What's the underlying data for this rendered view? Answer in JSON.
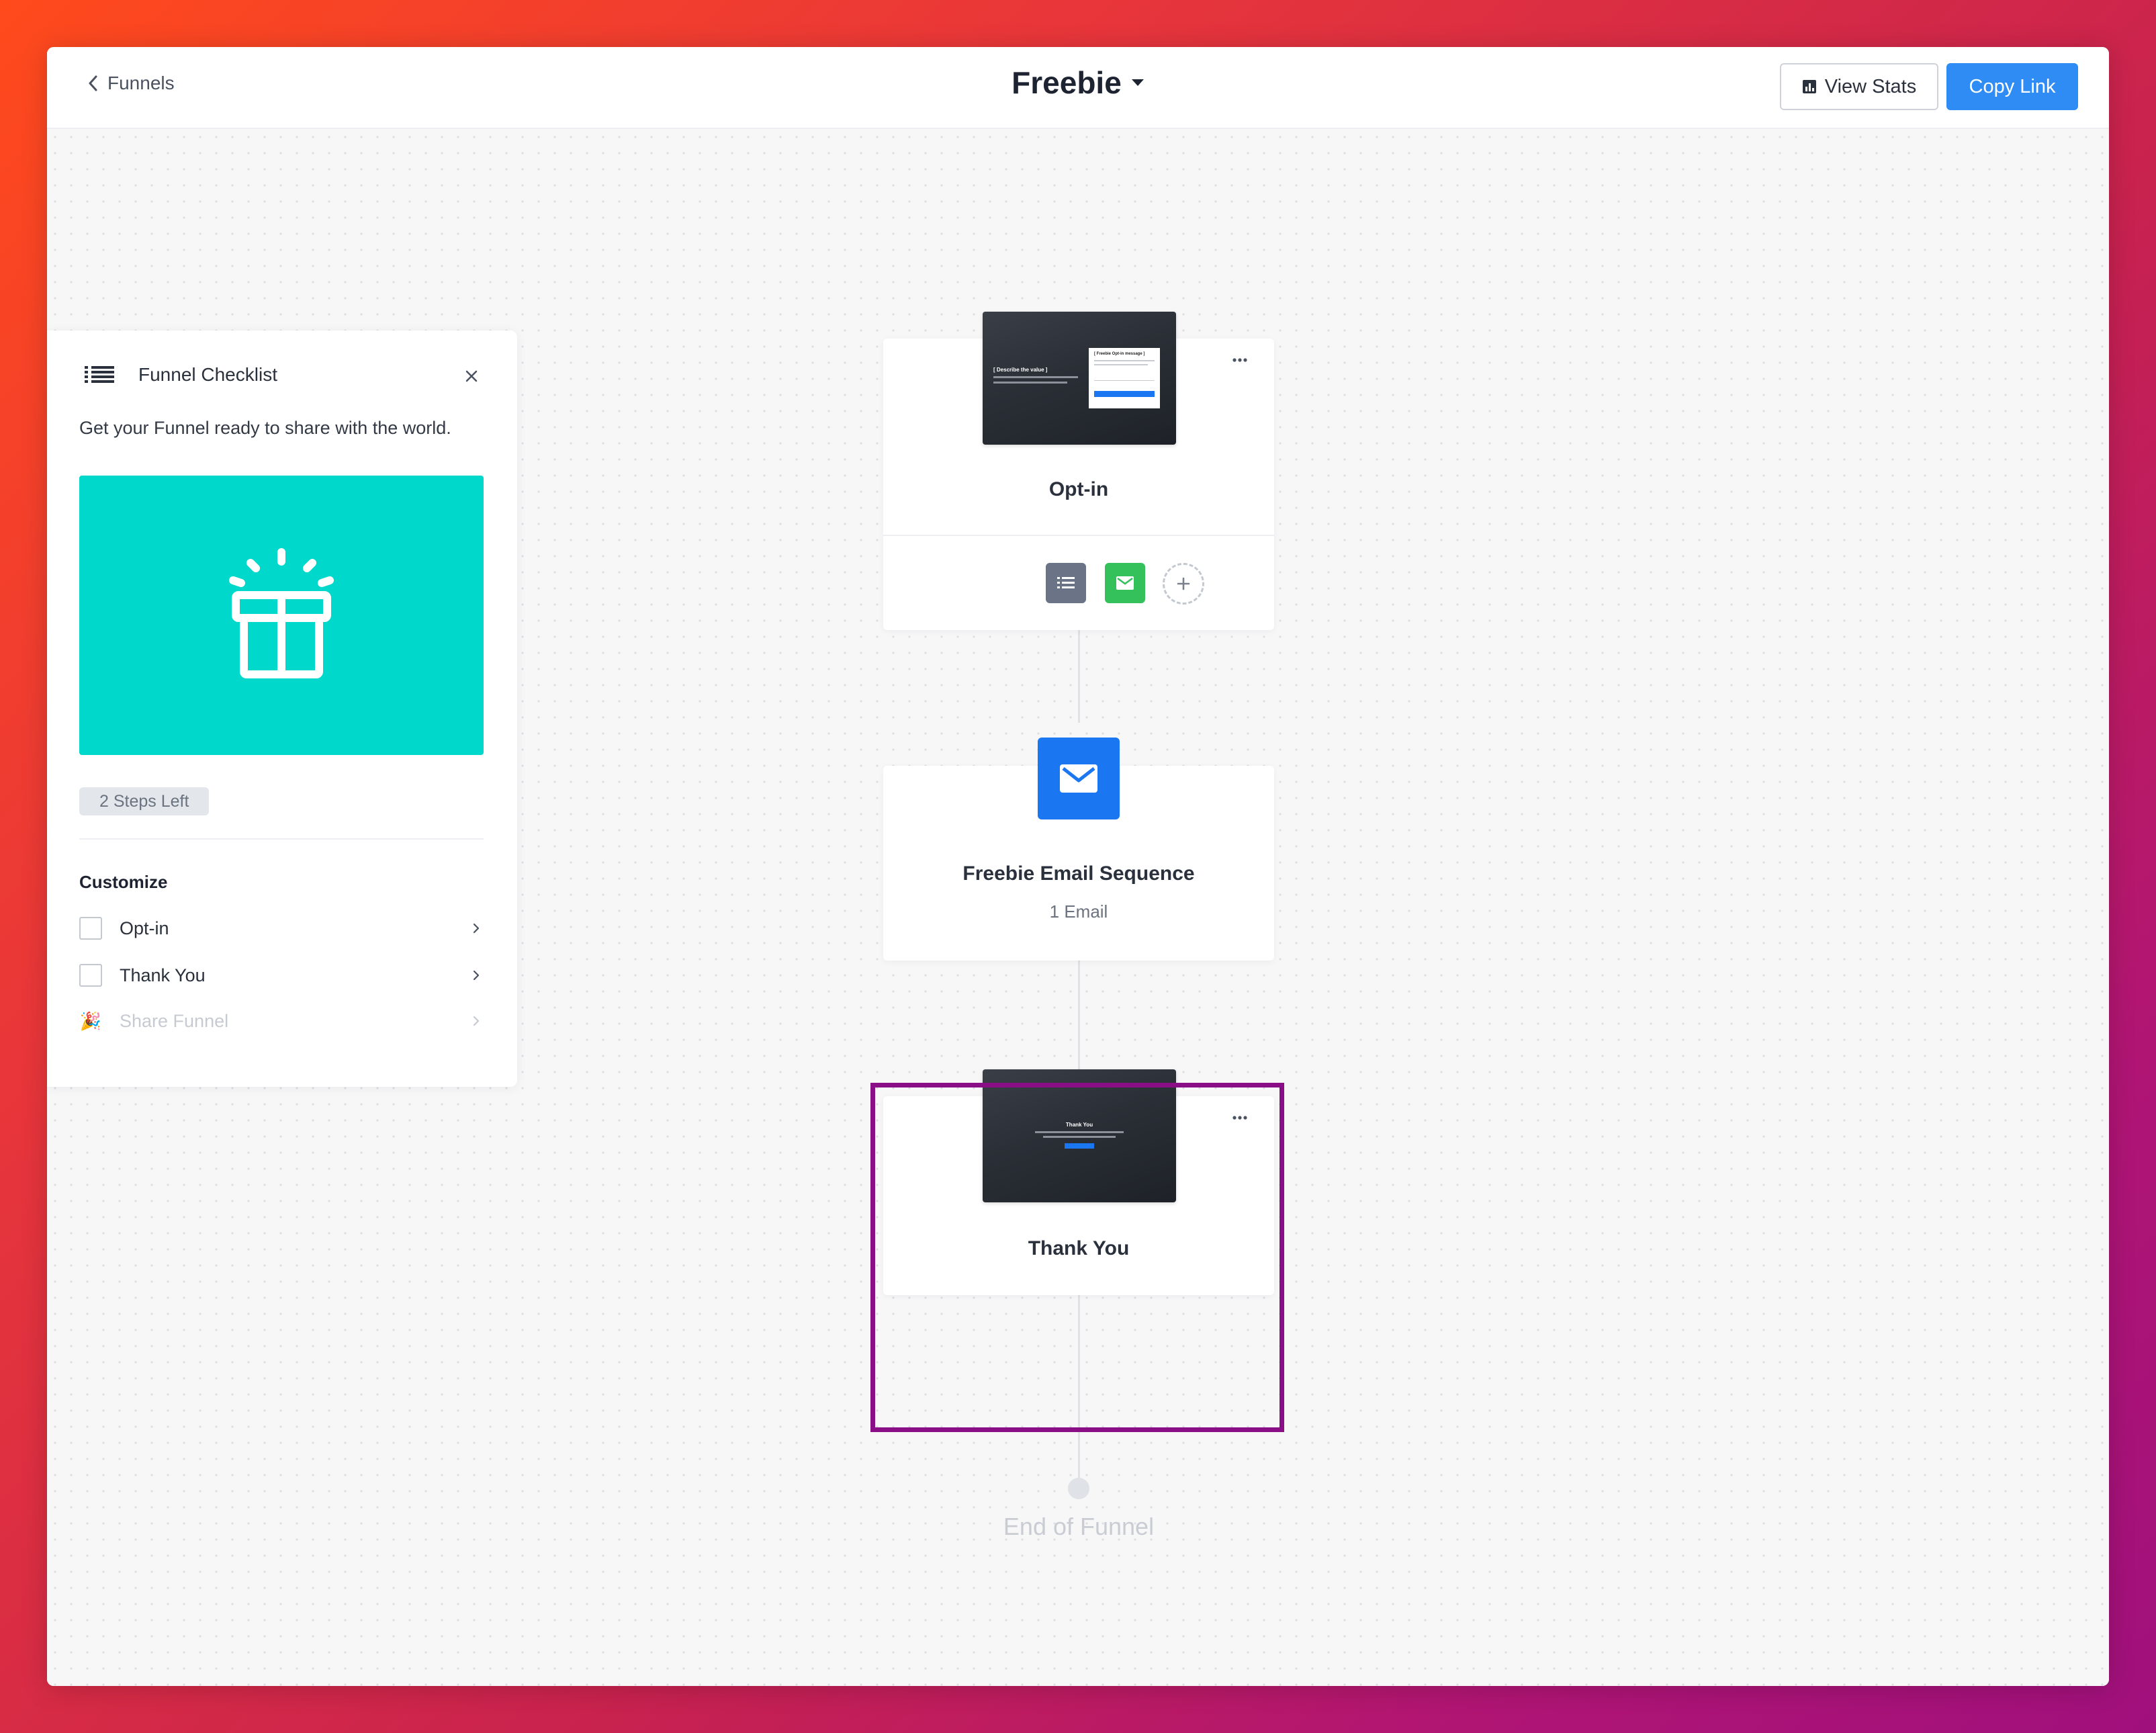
{
  "header": {
    "back_label": "Funnels",
    "title": "Freebie",
    "view_stats_label": "View Stats",
    "copy_link_label": "Copy Link"
  },
  "checklist": {
    "title": "Funnel Checklist",
    "description": "Get your Funnel ready to share with the world.",
    "steps_left": "2 Steps Left",
    "section_title": "Customize",
    "items": [
      {
        "label": "Opt-in",
        "checked": false
      },
      {
        "label": "Thank You",
        "checked": false
      },
      {
        "label": "Share Funnel",
        "disabled": true
      }
    ]
  },
  "funnel": {
    "steps": [
      {
        "label": "Opt-in",
        "thumbnail_heading": "[ Describe the value ]",
        "thumbnail_form_title": "[ Freebie Opt-in message ]"
      },
      {
        "label": "Freebie Email Sequence",
        "sublabel": "1 Email"
      },
      {
        "label": "Thank You",
        "thumbnail_heading": "Thank You"
      }
    ],
    "end_label": "End of Funnel"
  },
  "colors": {
    "accent": "#2f8cf5",
    "hero": "#00d8cc",
    "email_icon_bg": "#1b76f2",
    "list_icon_bg": "#6b7486",
    "mail_icon_bg": "#34c05a",
    "highlight": "#8a0f86"
  }
}
